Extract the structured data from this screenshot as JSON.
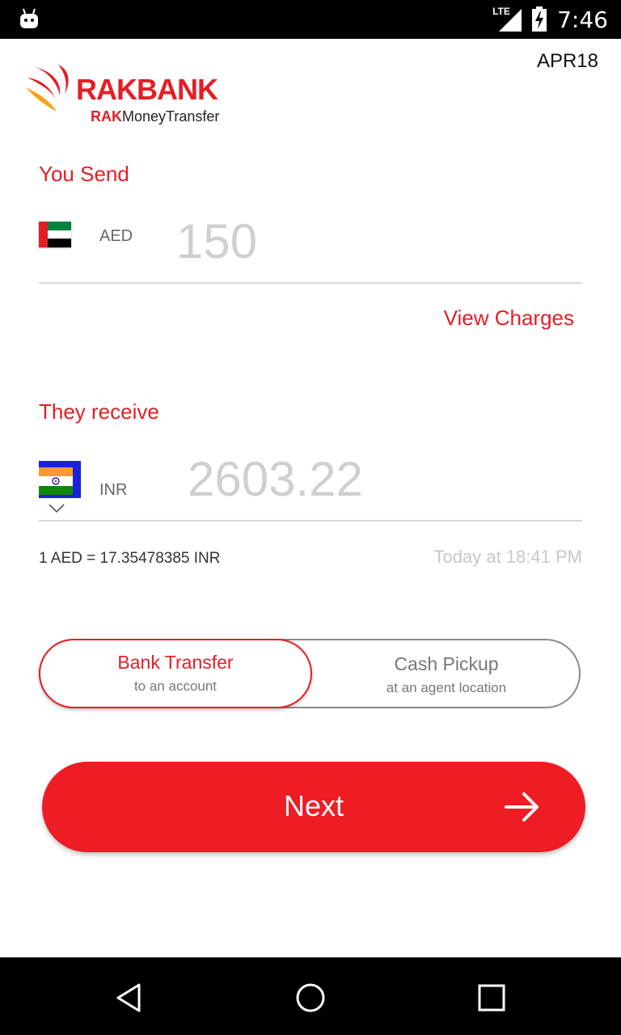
{
  "status_bar": {
    "time": "7:46",
    "network": "LTE"
  },
  "brand": {
    "name": "RAKBANK",
    "sub_bold": "RAK",
    "sub_rest": "MoneyTransfer"
  },
  "version": "APR18",
  "send": {
    "label": "You Send",
    "currency": "AED",
    "amount": "150",
    "flag": "uae-flag-icon"
  },
  "view_charges": "View Charges",
  "receive": {
    "label": "They receive",
    "currency": "INR",
    "amount": "2603.22",
    "flag": "india-flag-icon"
  },
  "rate": {
    "text": "1 AED = 17.35478385 INR",
    "timestamp": "Today at 18:41 PM"
  },
  "transfer_options": [
    {
      "title": "Bank Transfer",
      "subtitle": "to an account",
      "selected": true
    },
    {
      "title": "Cash Pickup",
      "subtitle": "at an agent location",
      "selected": false
    }
  ],
  "next_button": {
    "label": "Next",
    "icon": "arrow-right-icon"
  },
  "colors": {
    "brand_red": "#e41e26",
    "button_red": "#ee1c24"
  },
  "nav": {
    "icons": [
      "back-icon",
      "home-icon",
      "recents-icon"
    ]
  }
}
